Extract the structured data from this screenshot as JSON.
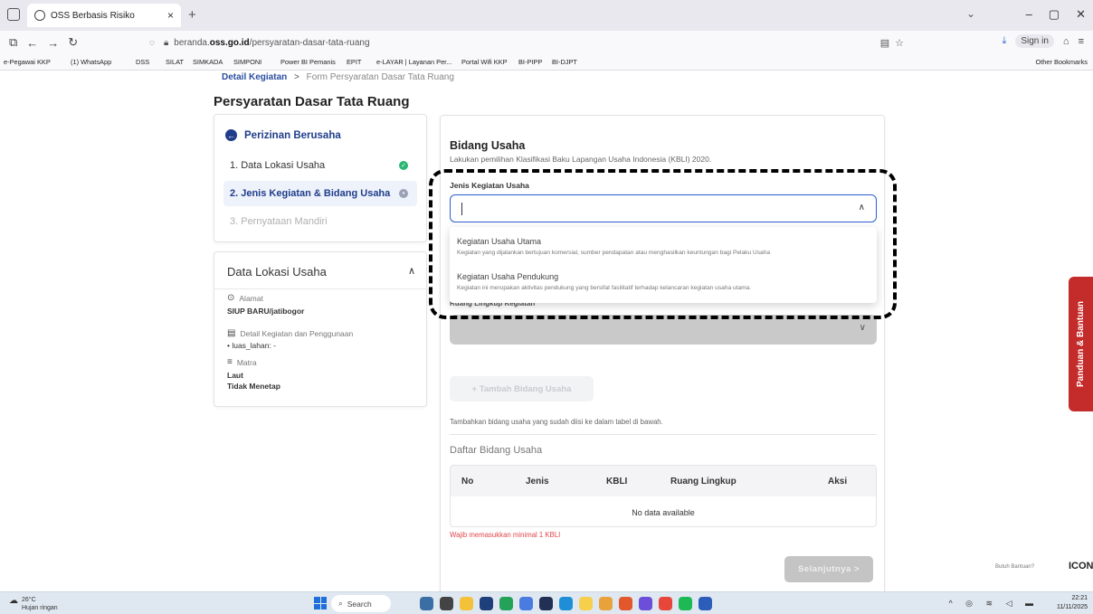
{
  "browser": {
    "tab_title": "OSS Berbasis Risiko",
    "tab_close": "×",
    "new_tab": "+",
    "url_prefix": "beranda.",
    "url_domain": "oss.go.id",
    "url_path": "/persyaratan-dasar-tata-ruang",
    "sign_in": "Sign in",
    "bookmarks": [
      "e-Pegawai KKP",
      "(1) WhatsApp",
      "DSS",
      "SILAT",
      "SIMKADA",
      "SIMPONI",
      "Power BI Pemanis",
      "EPIT",
      "e-LAYAR | Layanan Per...",
      "Portal Wifi KKP",
      "BI-PIPP",
      "BI-DJPT"
    ],
    "other_bookmarks": "Other Bookmarks"
  },
  "breadcrumb": {
    "active": "Detail Kegiatan",
    "separator": ">",
    "current": "Form Persyaratan Dasar Tata Ruang"
  },
  "page_title": "Persyaratan Dasar Tata Ruang",
  "steps": {
    "header": "Perizinan Berusaha",
    "items": [
      {
        "label": "1. Data Lokasi Usaha",
        "status": "done"
      },
      {
        "label": "2. Jenis Kegiatan & Bidang Usaha",
        "status": "current"
      },
      {
        "label": "3. Pernyataan Mandiri",
        "status": "pending"
      }
    ]
  },
  "lokasi": {
    "title": "Data Lokasi Usaha",
    "alamat_label": "Alamat",
    "alamat_value": "SIUP BARU/jatibogor",
    "detail_label": "Detail Kegiatan dan Penggunaan",
    "detail_value": "• luas_lahan: -",
    "matra_label": "Matra",
    "matra_value_1": "Laut",
    "matra_value_2": "Tidak Menetap"
  },
  "bidang_usaha": {
    "title": "Bidang Usaha",
    "description": "Lakukan pemilihan Klasifikasi Baku Lapangan Usaha Indonesia (KBLI) 2020.",
    "jenis_label": "Jenis Kegiatan Usaha",
    "options": [
      {
        "title": "Kegiatan Usaha Utama",
        "desc": "Kegiatan yang dijalankan bertujuan komersial, sumber pendapatan atau menghasilkan keuntungan bagi Pelaku Usaha"
      },
      {
        "title": "Kegiatan Usaha Pendukung",
        "desc": "Kegiatan ini merupakan aktivitas pendukung yang bersifat fasilitatif terhadap kelancaran kegiatan usaha utama."
      }
    ],
    "ruang_label": "Ruang Lingkup Kegiatan",
    "add_button": "+ Tambah Bidang Usaha",
    "helper": "Tambahkan bidang usaha yang sudah diisi ke dalam tabel di bawah.",
    "list_title": "Daftar Bidang Usaha",
    "table_headers": [
      "No",
      "Jenis",
      "KBLI",
      "Ruang Lingkup",
      "Aksi"
    ],
    "empty_text": "No data available",
    "error": "Wajib memasukkan minimal 1 KBLI",
    "next_button": "Selanjutnya >"
  },
  "help": {
    "tab_label": "Panduan & Bantuan",
    "butuh": "Butuh Bantuan?",
    "logo": "ICON"
  },
  "taskbar": {
    "temp": "26°C",
    "weather": "Hujan ringan",
    "search": "Search",
    "time": "22:21",
    "date": "11/11/2025"
  }
}
